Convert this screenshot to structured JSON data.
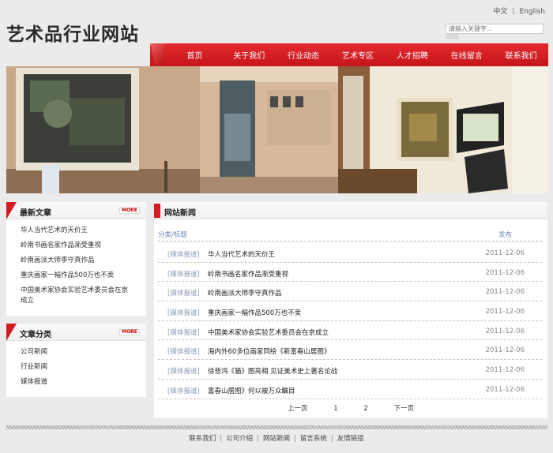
{
  "header": {
    "site_title": "艺术品行业网站",
    "lang_cn": "中文",
    "lang_sep": "|",
    "lang_en": "English",
    "search_placeholder": "请输入关键字..."
  },
  "nav": {
    "items": [
      "首页",
      "关于我们",
      "行业动态",
      "艺术专区",
      "人才招聘",
      "在线留言",
      "联系我们"
    ]
  },
  "colors": {
    "accent": "#d21c22",
    "nav_bg": "#d0191f",
    "page_bg": "#ebebeb",
    "link_muted": "#6a8ab8"
  },
  "sidebar": {
    "latest": {
      "title": "最新文章",
      "more": "MORE",
      "items": [
        "华人当代艺术的天价王",
        "岭南书画名家作品渐受重视",
        "岭南画派大师李守真作品",
        "重庆画家一幅作品500万也不卖",
        "中国美术家协会实验艺术委员会在京成立"
      ]
    },
    "categories": {
      "title": "文章分类",
      "more": "MORE",
      "items": [
        "公司新闻",
        "行业新闻",
        "媒体报道"
      ]
    }
  },
  "main": {
    "title": "网站新闻",
    "col_category": "分类/标题",
    "col_date": "发布",
    "rows": [
      {
        "cat": "[媒体报道]",
        "title": "华人当代艺术的天价王",
        "date": "2011-12-06"
      },
      {
        "cat": "[媒体报道]",
        "title": "岭南书画名家作品渐受重视",
        "date": "2011-12-06"
      },
      {
        "cat": "[媒体报道]",
        "title": "岭南画派大师李守真作品",
        "date": "2011-12-06"
      },
      {
        "cat": "[媒体报道]",
        "title": "重庆画家一幅作品500万也不卖",
        "date": "2011-12-06"
      },
      {
        "cat": "[媒体报道]",
        "title": "中国美术家协会实验艺术委员会在京成立",
        "date": "2011-12-06"
      },
      {
        "cat": "[媒体报道]",
        "title": "海内外60多位画家同绘《新富春山居图》",
        "date": "2011-12-06"
      },
      {
        "cat": "[媒体报道]",
        "title": "徐悲鸿《猫》图亮相 见证美术史上著名论战",
        "date": "2011-12-06"
      },
      {
        "cat": "[媒体报道]",
        "title": "富春山居图》何以被万众瞩目",
        "date": "2011-12-06"
      }
    ],
    "pager": {
      "prev": "上一页",
      "p1": "1",
      "p2": "2",
      "next": "下一页"
    }
  },
  "footer": {
    "links": [
      "联系我们",
      "公司介绍",
      "网站新闻",
      "留言系统",
      "友情链接"
    ],
    "sep": "|"
  }
}
